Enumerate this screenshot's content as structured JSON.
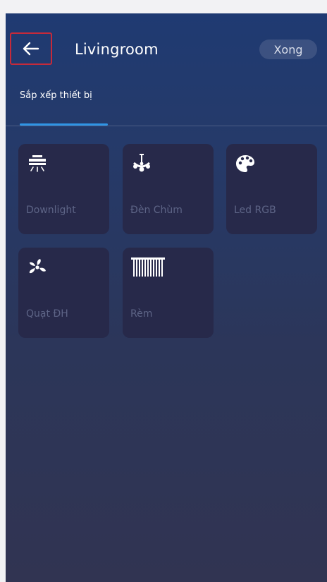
{
  "header": {
    "title": "Livingroom",
    "done_label": "Xong"
  },
  "tabs": [
    {
      "label": "Sắp xếp thiết bị",
      "active": true
    }
  ],
  "devices": [
    {
      "label": "Downlight",
      "icon": "downlight-icon"
    },
    {
      "label": "Đèn Chùm",
      "icon": "chandelier-icon"
    },
    {
      "label": "Led RGB",
      "icon": "palette-icon"
    },
    {
      "label": "Quạt ĐH",
      "icon": "fan-icon"
    },
    {
      "label": "Rèm",
      "icon": "curtain-icon"
    }
  ],
  "colors": {
    "accent": "#2f95e6",
    "highlight_border": "#c62a3a",
    "tile_bg": "#27294a",
    "tile_label": "#5d6486"
  }
}
